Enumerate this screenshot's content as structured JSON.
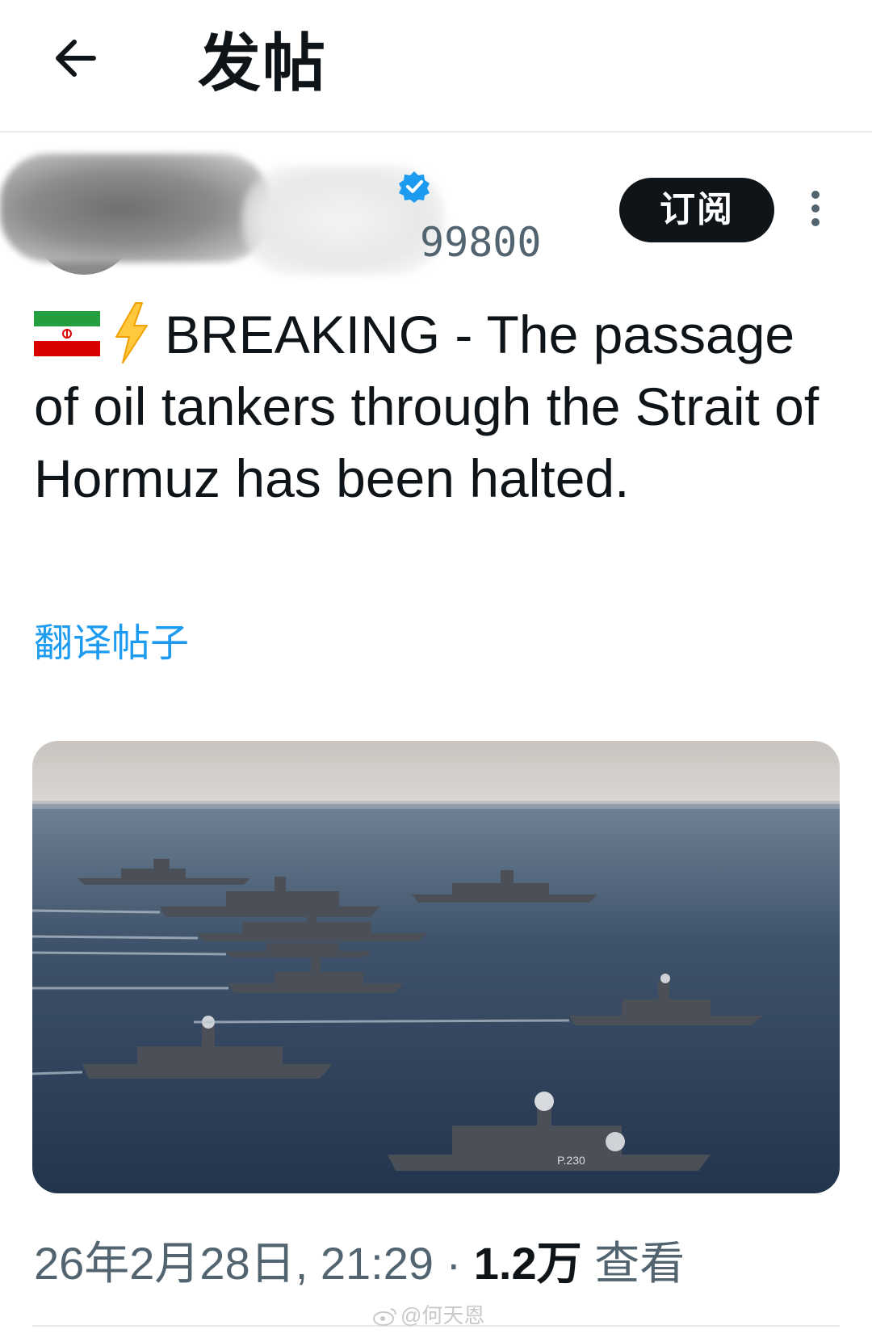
{
  "header": {
    "title": "发帖",
    "back_icon": "arrow-left-icon"
  },
  "author": {
    "handle_fragment": "99800",
    "verified_icon": "verified-badge-icon",
    "verified_color": "#1d9bf0",
    "subscribe_label": "订阅",
    "more_icon": "vertical-dots-icon"
  },
  "post": {
    "flag_icon": "iran-flag-icon",
    "emoji_icon": "lightning-bolt-icon",
    "text": "BREAKING - The passage of oil tankers through the Strait of Hormuz has been halted.",
    "translate_label": "翻译帖子",
    "translate_color": "#1d9bf0"
  },
  "media": {
    "hull_marking": "P.230"
  },
  "meta": {
    "datetime": "26年2月28日, 21:29",
    "separator": "·",
    "views_count": "1.2万",
    "views_label": "查看"
  },
  "watermark": {
    "text": "@何天恩",
    "icon": "weibo-icon"
  }
}
